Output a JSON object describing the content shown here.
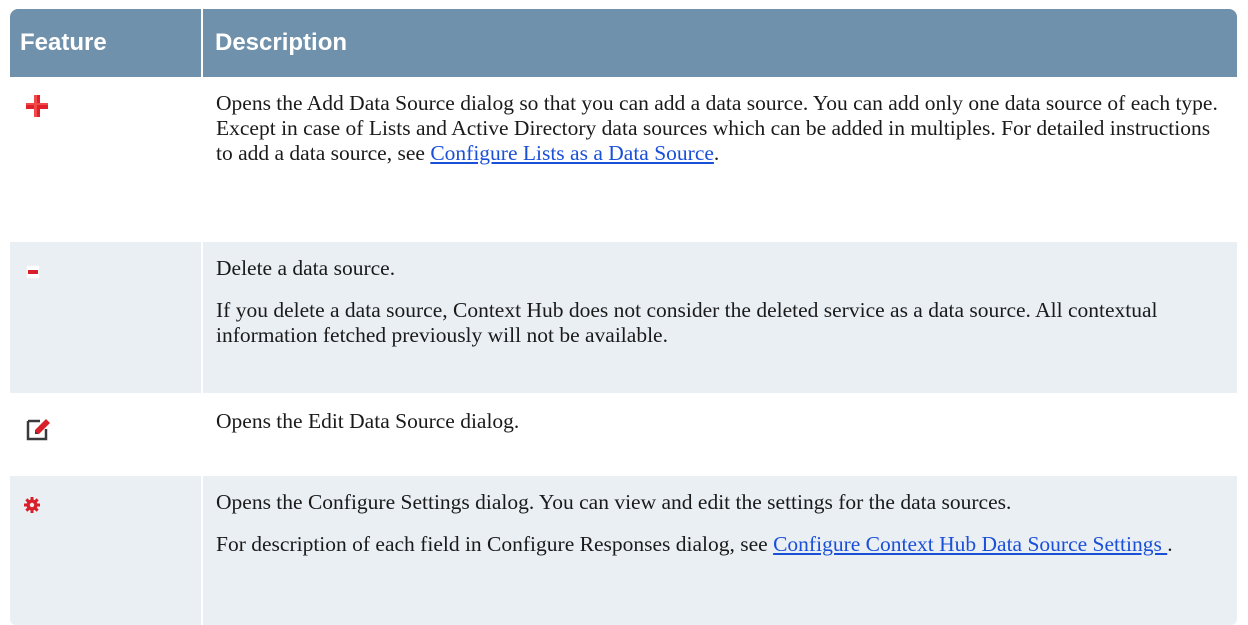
{
  "table": {
    "header": {
      "feature": "Feature",
      "description": "Description"
    },
    "rows": [
      {
        "icon": "plus-icon",
        "p1_text": "Opens the Add Data Source dialog so that you can add a data source. You can add only one data source of each type. Except in case of Lists and Active Directory data sources which can be added in multiples. For detailed instructions to add a data source, see ",
        "p1_link": "Configure Lists as a Data Source",
        "p1_after": "."
      },
      {
        "icon": "minus-icon",
        "p1": "Delete a data source.",
        "p2": "If you delete a data source, Context Hub does not consider the deleted service as a data source. All contextual information fetched previously will not be available."
      },
      {
        "icon": "edit-icon",
        "p1": "Opens the Edit Data Source dialog."
      },
      {
        "icon": "gear-icon",
        "p1": "Opens the Configure Settings dialog. You can view and edit the settings for the data sources.",
        "p2_text": "For description of each field in Configure Responses dialog, see ",
        "p2_link": "Configure Context Hub Data Source Settings ",
        "p2_after": "."
      }
    ]
  },
  "colors": {
    "header_bg": "#7091ab",
    "alt_row_bg": "#eaeff4",
    "plus_icon": "#e0202a",
    "minus_icon": "#d8202a",
    "gear_icon": "#d8202a",
    "link": "#1a4fd8"
  }
}
